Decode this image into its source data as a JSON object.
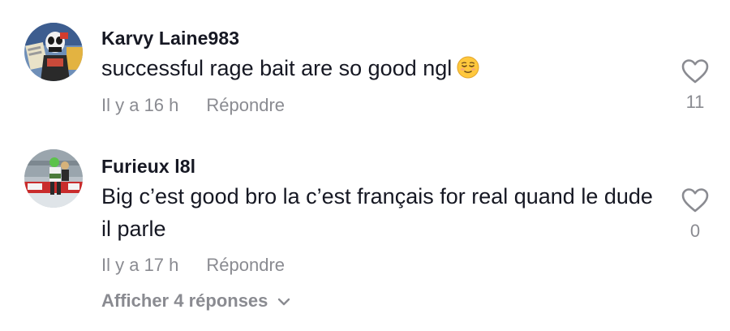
{
  "comments": [
    {
      "username": "Karvy Laine983",
      "text": "successful rage bait are so good ngl",
      "emoji": "relieved-face-emoji",
      "time": "Il y a 16 h",
      "reply_label": "Répondre",
      "likes": "11"
    },
    {
      "username": "Furieux l8l",
      "text": "Big c’est good bro la c’est français for real quand le dude il parle",
      "time": "Il y a 17 h",
      "reply_label": "Répondre",
      "likes": "0"
    }
  ],
  "view_replies_label": "Afficher 4 réponses",
  "icons": {
    "like": "heart-outline-icon",
    "expand": "chevron-down-icon"
  },
  "colors": {
    "text": "#161823",
    "secondary": "#8a8b91",
    "background": "#ffffff"
  }
}
